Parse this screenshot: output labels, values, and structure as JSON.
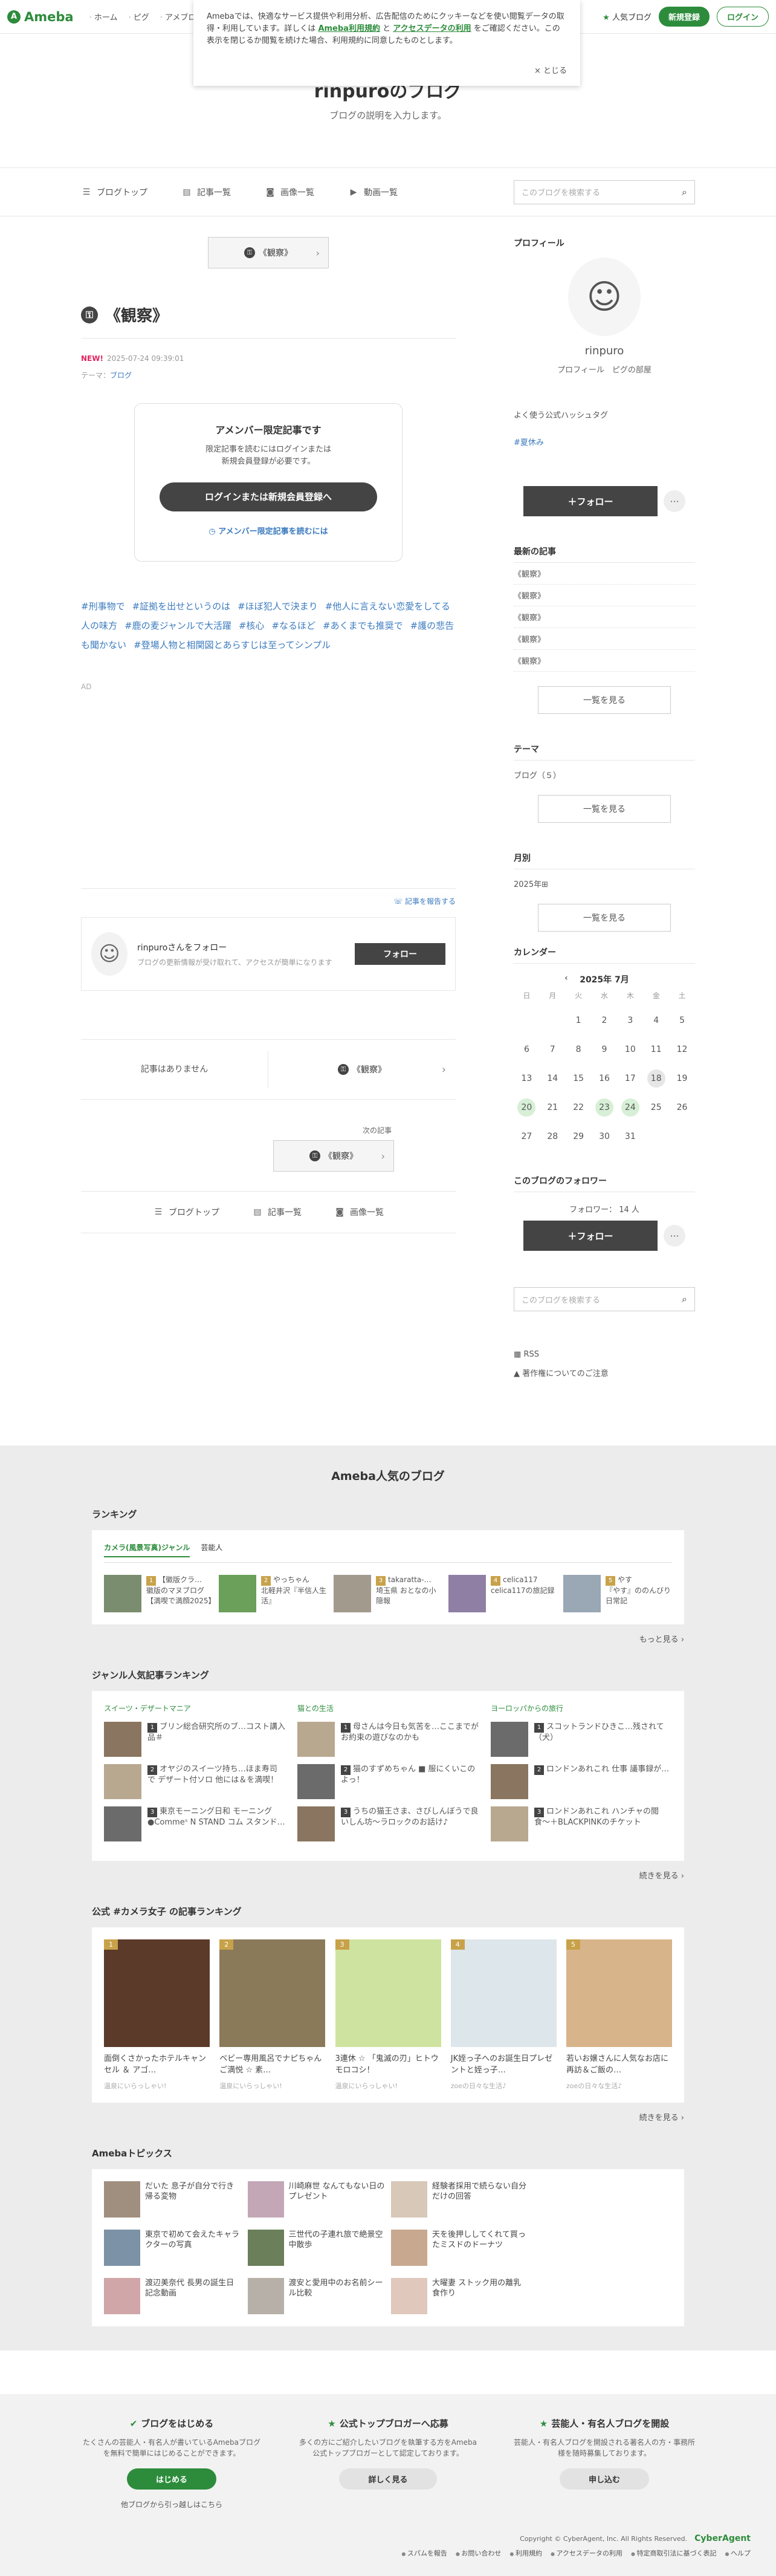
{
  "header": {
    "logo": "Ameba",
    "nav": [
      "ホーム",
      "ピグ",
      "アメブロ"
    ],
    "popular_blogs": "人気ブログ",
    "register": "新規登録",
    "login": "ログイン"
  },
  "notice": {
    "text1": "Amebaでは、快適なサービス提供や利用分析、広告配信のためにクッキーなどを使い閲覧データの取得・利用しています。詳しくは",
    "link1": "Ameba利用規約",
    "mid": "と",
    "link2": "アクセスデータの利用",
    "text2": "をご確認ください。この表示を閉じるか閲覧を続けた場合、利用規約に同意したものとします。",
    "close": "× とじる"
  },
  "blog": {
    "title": "rinpuroのブログ",
    "description": "ブログの説明を入力します。"
  },
  "blog_nav": {
    "items": [
      "ブログトップ",
      "記事一覧",
      "画像一覧",
      "動画一覧"
    ],
    "search_placeholder": "このブログを検索する"
  },
  "entry": {
    "prev_label": "《観察》",
    "title": "《観察》",
    "new_badge": "NEW!",
    "datetime": "2025-07-24 09:39:01",
    "theme_label": "テーマ：",
    "theme": "ブログ",
    "limited_title": "アメンバー限定記事です",
    "limited_text1": "限定記事を読むにはログインまたは",
    "limited_text2": "新規会員登録が必要です。",
    "login_button": "ログインまたは新規会員登録へ",
    "how_to_read": "アメンバー限定記事を読むには",
    "hashtags": [
      "#刑事物で",
      "#証拠を出せというのは",
      "#ほぼ犯人で決まり",
      "#他人に言えない恋愛をしてる人の味方",
      "#鹿の麦ジャンルで大活躍",
      "#核心",
      "#なるほど",
      "#あくまでも推奨で",
      "#護の悲告も聞かない",
      "#登場人物と相関図とあらすじは至ってシンプル"
    ],
    "ad": "AD",
    "report": "記事を報告する",
    "follow_title": "rinpuroさんをフォロー",
    "follow_desc": "ブログの更新情報が受け取れて、アクセスが簡単になります",
    "follow_button": "フォロー",
    "no_prev": "記事はありません",
    "next_entry": "《観察》",
    "next_label": "次の記事",
    "next_btn": "《観察》"
  },
  "bottom_nav": [
    "ブログトップ",
    "記事一覧",
    "画像一覧"
  ],
  "sidebar": {
    "profile_heading": "プロフィール",
    "name": "rinpuro",
    "profile_links": "プロフィール　ピグの部屋",
    "hashtag_heading": "よく使う公式ハッシュタグ",
    "hashtag": "#夏休み",
    "follow_button": "＋フォロー",
    "recent_heading": "最新の記事",
    "recent": [
      "《観察》",
      "《観察》",
      "《観察》",
      "《観察》",
      "《観察》"
    ],
    "see_more": "一覧を見る",
    "theme_heading": "テーマ",
    "theme_item": "ブログ（５）",
    "monthly_heading": "月別",
    "monthly_item": "2025年⊞",
    "calendar_heading": "カレンダー",
    "calendar_month": "2025年 7月",
    "weekdays": [
      "日",
      "月",
      "火",
      "水",
      "木",
      "金",
      "土"
    ],
    "days": [
      "",
      "",
      "1",
      "2",
      "3",
      "4",
      "5",
      "6",
      "7",
      "8",
      "9",
      "10",
      "11",
      "12",
      "13",
      "14",
      "15",
      "16",
      "17",
      "18",
      "19",
      "20",
      "21",
      "22",
      "23",
      "24",
      "25",
      "26",
      "27",
      "28",
      "29",
      "30",
      "31",
      "",
      ""
    ],
    "followers_heading": "このブログのフォロワー",
    "followers": "フォロワー： 14 人",
    "search_placeholder": "このブログを検索する",
    "rss": "RSS",
    "copyright_notice": "著作権についてのご注意"
  },
  "popular": {
    "heading": "Ameba人気のブログ",
    "ranking_title": "ランキング",
    "tabs": [
      "カメラ(風景写真)ジャンル",
      "芸能人"
    ],
    "ranking": [
      {
        "rank": "1",
        "name": "【徽版クラ…",
        "desc": "徽版のマヌブログ【満喫で満顔2025】"
      },
      {
        "rank": "2",
        "name": "やっちゃん",
        "desc": "北軽井沢『半信人生活』"
      },
      {
        "rank": "3",
        "name": "takaratta-…",
        "desc": "埼玉県 おとなの小隠報"
      },
      {
        "rank": "4",
        "name": "celica117",
        "desc": "celica117の旅記録"
      },
      {
        "rank": "5",
        "name": "やす",
        "desc": "『やす』ののんびり日常記"
      }
    ],
    "more": "もっと見る",
    "genre_title": "ジャンル人気記事ランキング",
    "genres": [
      {
        "name": "スイーツ・デザートマニア",
        "items": [
          "ブリン総合研究所のブ…コスト講入品＃",
          "オヤジのスイーツ持ち…ほま寿司 で デザート付ソロ 他には＆を満喫！",
          "東京モーニング日和 モーニング●Commeˢ N STAND コム スタンド…"
        ]
      },
      {
        "name": "猫との生活",
        "items": [
          "母さんは今日も気苦を…ここまでがお約束の遊びなのかも",
          "猫のすずめちゃん ■ 服にくいこのよっ！",
          "うちの猫王さま、さびしんぼうで良いしん坊〜ラロックのお話け♪"
        ]
      },
      {
        "name": "ヨーロッパからの旅行",
        "items": [
          "スコットランドひきこ…残されて（犬）",
          "ロンドンあれこれ 仕事 議事録が…",
          "ロンドンあれこれ ハンチャの閲食〜＋BLACKPINKのチケット"
        ]
      }
    ],
    "more2": "続きを見る",
    "camera_title": "公式 #カメラ女子 の記事ランキング",
    "camera": [
      {
        "rank": "1",
        "title": "面倒くさかったホテルキャンセル ＆ アゴ…",
        "sub": "温泉にいらっしゃい!"
      },
      {
        "rank": "2",
        "title": "ベビー専用風呂でナピちゃんご満悦 ☆ 素…",
        "sub": "温泉にいらっしゃい!"
      },
      {
        "rank": "3",
        "title": "3連休 ☆ 「鬼滅の刃」ヒトウモロコシ！",
        "sub": "温泉にいらっしゃい!"
      },
      {
        "rank": "4",
        "title": "JK姪っ子へのお誕生日プレゼントと姪っ子…",
        "sub": "zoeの日々な生活♪"
      },
      {
        "rank": "5",
        "title": "若いお嬢さんに人気なお店に再訪＆ご飯の…",
        "sub": "zoeの日々な生活♪"
      }
    ],
    "more3": "続きを見る",
    "topics_title": "Amebaトピックス",
    "topics": [
      "だいた 息子が自分で行き帰る変物",
      "川崎麻世 なんてもない日のプレゼント",
      "経験者採用で続らない自分だけの回答",
      "",
      "東京で初めて会えたキャラクターの写真",
      "三世代の子連れ旅で絶景空中散歩",
      "天を後押ししてくれて買ったミスドのドーナツ",
      "",
      "渡辺美奈代 長男の誕生日記念動画",
      "渡安と愛用中のお名前シール比較",
      "大曜妻 ストック用の離乳食作り",
      ""
    ]
  },
  "footer": {
    "cols": [
      {
        "title": "ブログをはじめる",
        "desc": "たくさんの芸能人・有名人が書いているAmebaブログを無料で簡単にはじめることができます。",
        "button": "はじめる",
        "extra": "他ブログから引っ越しはこちら"
      },
      {
        "title": "公式トップブロガーへ応募",
        "desc": "多くの方にご紹介したいブログを執筆する方をAmeba公式トップブロガーとして認定しております。",
        "button": "詳しく見る",
        "extra": ""
      },
      {
        "title": "芸能人・有名人ブログを開設",
        "desc": "芸能人・有名人ブログを開設される著名人の方・事務所様を随時募集しております。",
        "button": "申し込む",
        "extra": ""
      }
    ],
    "copyright": "Copyright © CyberAgent, Inc. All Rights Reserved.",
    "company": "CyberAgent",
    "links": [
      "スパムを報告",
      "お問い合わせ",
      "利用規約",
      "アクセスデータの利用",
      "特定商取引法に基づく表記",
      "ヘルプ"
    ]
  }
}
